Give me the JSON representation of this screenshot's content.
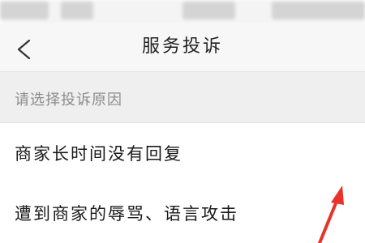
{
  "nav": {
    "title": "服务投诉",
    "back_icon": "chevron-left-icon"
  },
  "section": {
    "header": "请选择投诉原因"
  },
  "reasons": [
    {
      "label": "商家长时间没有回复"
    },
    {
      "label": "遭到商家的辱骂、语言攻击"
    }
  ],
  "colors": {
    "nav_bg": "#f7f7f7",
    "section_bg": "#efefef",
    "annotation_arrow": "#e8322a"
  }
}
